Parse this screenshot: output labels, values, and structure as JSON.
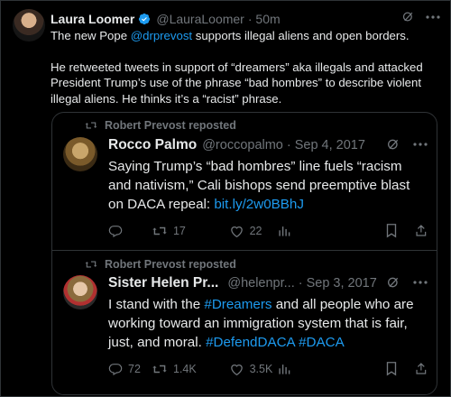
{
  "main_post": {
    "author_name": "Laura Loomer",
    "author_handle": "@LauraLoomer",
    "time": "· 50m",
    "text_prefix": "The new Pope ",
    "mention": "@drprevost",
    "text_suffix": " supports illegal aliens and open borders.",
    "paragraph2": "He retweeted tweets in support of “dreamers” aka illegals and attacked President Trump’s use of the phrase “bad hombres” to describe violent illegal aliens. He thinks it’s a “racist” phrase."
  },
  "quoted": {
    "tweets": [
      {
        "repost_label": "Robert Prevost reposted",
        "author_name": "Rocco Palmo",
        "author_handle": "@roccopalmo",
        "date": "· Sep 4, 2017",
        "text": "Saying Trump’s “bad hombres” line fuels “racism and nativism,” Cali bishops send preemptive blast on DACA repeal: ",
        "link": "bit.ly/2w0BBhJ",
        "replies": "",
        "retweets": "17",
        "likes": "22"
      },
      {
        "repost_label": "Robert Prevost reposted",
        "author_name": "Sister Helen Pr...",
        "author_handle": "@helenpr...",
        "date": "· Sep 3, 2017",
        "text_a": "I stand with the ",
        "hashtag1": "#Dreamers",
        "text_b": " and all people who are working toward an immigration system that is fair, just, and moral. ",
        "hashtag2": "#DefendDACA",
        "text_c": " ",
        "hashtag3": "#DACA",
        "replies": "72",
        "retweets": "1.4K",
        "likes": "3.5K"
      }
    ]
  },
  "colors": {
    "accent": "#1d9bf0",
    "muted": "#71767b",
    "text": "#e7e9ea",
    "border": "#2f3336",
    "background": "#000000"
  }
}
